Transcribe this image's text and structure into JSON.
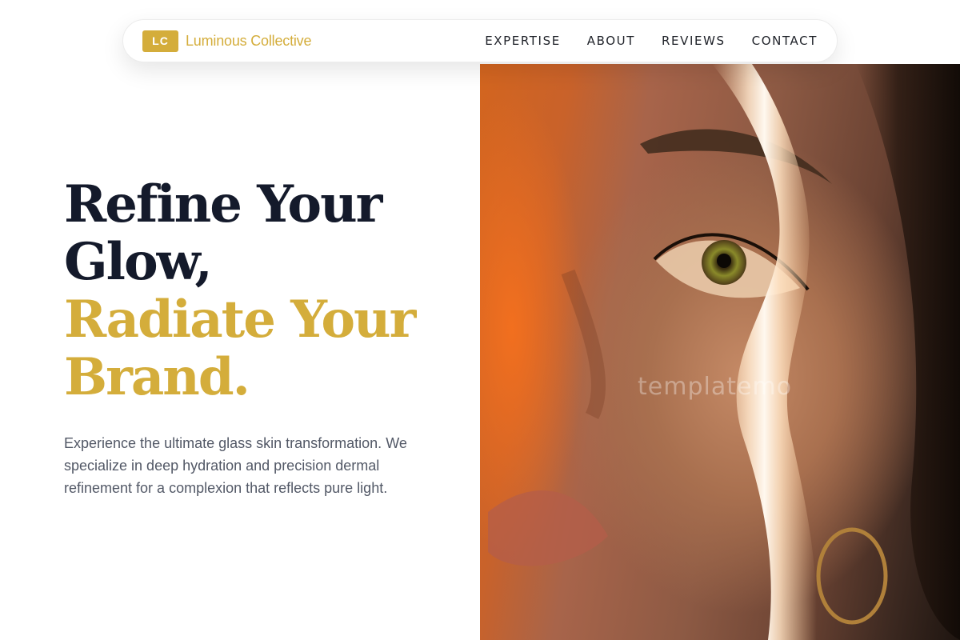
{
  "nav": {
    "brand_badge": "LC",
    "brand_name": "Luminous Collective",
    "items": [
      {
        "label": "EXPERTISE"
      },
      {
        "label": "ABOUT"
      },
      {
        "label": "REVIEWS"
      },
      {
        "label": "CONTACT"
      }
    ]
  },
  "hero": {
    "headline_lines": [
      "Refine Your",
      "Glow,"
    ],
    "headline_accent_lines": [
      "Radiate Your",
      "Brand."
    ],
    "description": "Experience the ultimate glass skin transformation. We specialize in deep hydration and precision dermal refinement for a complexion that reflects pure light."
  },
  "image": {
    "watermark": "templatemo"
  },
  "colors": {
    "accent": "#d4ad3b",
    "heading": "#141a2b",
    "body_text": "#525866"
  }
}
